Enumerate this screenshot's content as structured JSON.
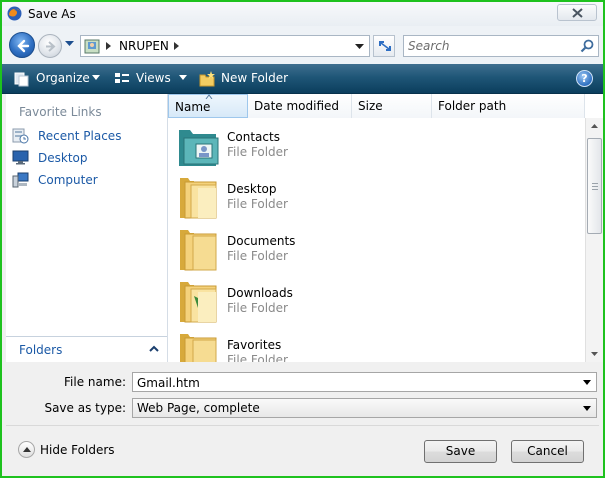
{
  "window": {
    "title": "Save As"
  },
  "address": {
    "path": [
      "NRUPEN"
    ]
  },
  "search": {
    "placeholder": "Search"
  },
  "toolbar": {
    "organize": "Organize",
    "views": "Views",
    "new_folder": "New Folder",
    "help": "?"
  },
  "sidebar": {
    "favorites_title": "Favorite Links",
    "links": [
      {
        "label": "Recent Places",
        "icon": "recent-places-icon"
      },
      {
        "label": "Desktop",
        "icon": "desktop-icon"
      },
      {
        "label": "Computer",
        "icon": "computer-icon"
      }
    ],
    "folders_label": "Folders"
  },
  "columns": [
    "Name",
    "Date modified",
    "Size",
    "Folder path"
  ],
  "files": [
    {
      "name": "Contacts",
      "type": "File Folder",
      "icon": "contacts-folder-icon"
    },
    {
      "name": "Desktop",
      "type": "File Folder",
      "icon": "folder-icon"
    },
    {
      "name": "Documents",
      "type": "File Folder",
      "icon": "folder-icon"
    },
    {
      "name": "Downloads",
      "type": "File Folder",
      "icon": "folder-icon"
    },
    {
      "name": "Favorites",
      "type": "File Folder",
      "icon": "folder-icon"
    }
  ],
  "form": {
    "file_name_label": "File name:",
    "file_name_value": "Gmail.htm",
    "save_type_label": "Save as type:",
    "save_type_value": "Web Page, complete"
  },
  "footer": {
    "hide_folders": "Hide Folders",
    "save": "Save",
    "cancel": "Cancel"
  },
  "colors": {
    "toolbar": "#1f5677",
    "link": "#1b59a6",
    "window_border": "#1ec21e"
  }
}
